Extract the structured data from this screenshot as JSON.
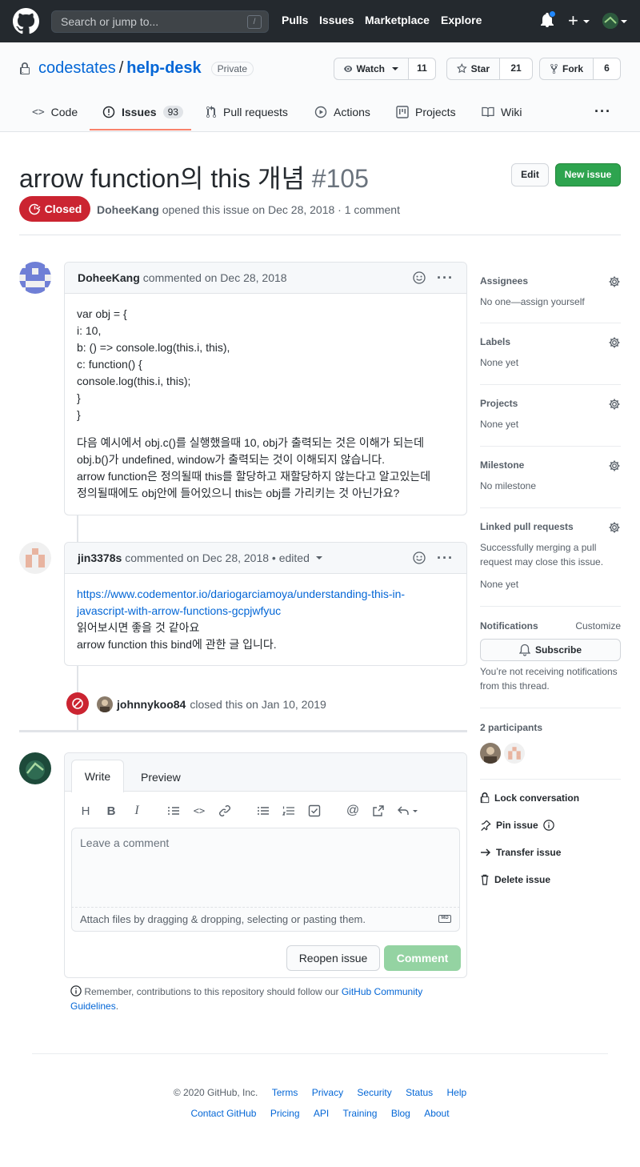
{
  "header": {
    "search_placeholder": "Search or jump to...",
    "search_key": "/",
    "nav": [
      "Pulls",
      "Issues",
      "Marketplace",
      "Explore"
    ]
  },
  "repo": {
    "owner": "codestates",
    "separator": "/",
    "name": "help-desk",
    "visibility": "Private",
    "watch_label": "Watch",
    "watch_count": "11",
    "star_label": "Star",
    "star_count": "21",
    "fork_label": "Fork",
    "fork_count": "6",
    "tabs": [
      {
        "label": "Code"
      },
      {
        "label": "Issues",
        "count": "93"
      },
      {
        "label": "Pull requests"
      },
      {
        "label": "Actions"
      },
      {
        "label": "Projects"
      },
      {
        "label": "Wiki"
      }
    ],
    "more": "···"
  },
  "issue": {
    "title": "arrow function의 this 개념",
    "number": "#105",
    "edit_label": "Edit",
    "new_issue_label": "New issue",
    "state": "Closed",
    "author": "DoheeKang",
    "meta_text": "opened this issue on Dec 28, 2018 · 1 comment"
  },
  "comments": [
    {
      "author": "DoheeKang",
      "meta": "commented on Dec 28, 2018",
      "code_lines": [
        "var obj = {",
        "i: 10,",
        "b: () => console.log(this.i, this),",
        "c: function() {",
        "console.log(this.i, this);",
        "}",
        "}"
      ],
      "text_lines": [
        "다음 예시에서 obj.c()를 실행했을때 10, obj가 출력되는 것은 이해가 되는데",
        "obj.b()가 undefined, window가 출력되는 것이 이해되지 않습니다.",
        "arrow function은 정의될때 this를 할당하고 재할당하지 않는다고 알고있는데",
        "정의될때에도 obj안에 들어있으니 this는 obj를 가리키는 것 아닌가요?"
      ]
    },
    {
      "author": "jin3378s",
      "meta": "commented on Dec 28, 2018 • edited",
      "link_line1": "https://www.codementor.io/dariogarciamoya/understanding-this-in-",
      "link_line2": "javascript-with-arrow-functions-gcpjwfyuc",
      "text_lines": [
        "읽어보시면 좋을 것 같아요",
        "arrow function this bind에 관한 글 입니다."
      ]
    }
  ],
  "close_event": {
    "actor": "johnnykoo84",
    "text": "closed this on Jan 10, 2019"
  },
  "form": {
    "write_tab": "Write",
    "preview_tab": "Preview",
    "placeholder": "Leave a comment",
    "attach_text": "Attach files by dragging & dropping, selecting or pasting them.",
    "md_badge": "MD",
    "reopen_label": "Reopen issue",
    "comment_label": "Comment",
    "guide_text": "Remember, contributions to this repository should follow our",
    "guide_link": "GitHub Community Guidelines",
    "guide_end": "."
  },
  "sidebar": {
    "assignees_title": "Assignees",
    "assignees_value": "No one—assign yourself",
    "labels_title": "Labels",
    "labels_value": "None yet",
    "projects_title": "Projects",
    "projects_value": "None yet",
    "milestone_title": "Milestone",
    "milestone_value": "No milestone",
    "linked_title": "Linked pull requests",
    "linked_desc": "Successfully merging a pull request may close this issue.",
    "linked_value": "None yet",
    "notifications_title": "Notifications",
    "customize": "Customize",
    "subscribe": "Subscribe",
    "notif_desc": "You’re not receiving notifications from this thread.",
    "participants_title": "2 participants",
    "lock": "Lock conversation",
    "pin": "Pin issue",
    "transfer": "Transfer issue",
    "delete": "Delete issue"
  },
  "footer": {
    "copyright": "© 2020 GitHub, Inc.",
    "links1": [
      "Terms",
      "Privacy",
      "Security",
      "Status",
      "Help"
    ],
    "links2": [
      "Contact GitHub",
      "Pricing",
      "API",
      "Training",
      "Blog",
      "About"
    ]
  },
  "colors": {
    "closed": "#cb2431",
    "primary": "#2ea44f",
    "link": "#0366d6",
    "tab_accent": "#f9826c"
  }
}
